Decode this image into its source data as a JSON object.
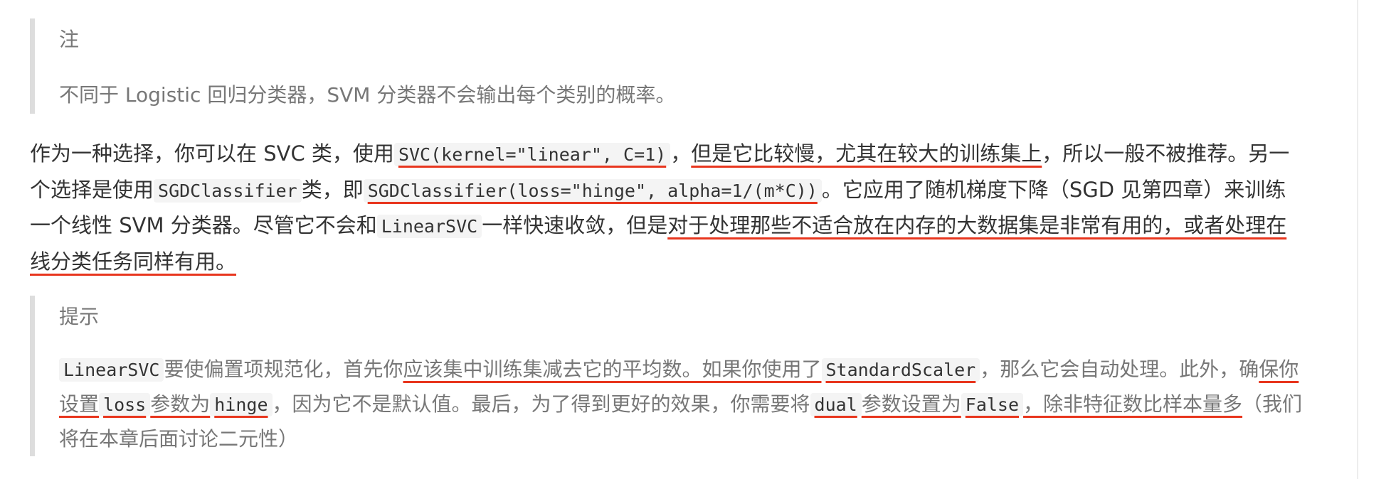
{
  "note": {
    "title": "注",
    "text": "不同于 Logistic 回归分类器，SVM 分类器不会输出每个类别的概率。"
  },
  "paragraph": {
    "p1": "作为一种选择，你可以在 SVC 类，使用",
    "code1": "SVC(kernel=\"linear\", C=1)",
    "p2": "，",
    "p3_u": "但是它比较慢，尤其在较大的训练集上",
    "p4": "，所以一般不被推荐。另一个选择是使用",
    "code2": "SGDClassifier",
    "p5": "类，即",
    "code3": "SGDClassifier(loss=\"hinge\", alpha=1/(m*C))",
    "p6": "。它应用了随机梯度下降（SGD 见第四章）来训练一个线性 SVM 分类器。尽管它不会和",
    "code4": "LinearSVC",
    "p7": "一样快速收敛，但是",
    "p8_u": "对于处理那些不适合放在内存的大数据集是非常有用的，或者处理在线分类任务同样有用。"
  },
  "tip": {
    "title": "提示",
    "code1": "LinearSVC",
    "t1": "要使偏置项规范化，首先你",
    "t2_u": "应该集中训练集减去它的平均数。如果你使用了",
    "code2": "StandardScaler",
    "t3": "，那么它会自动处理。此外，确",
    "t4_u": "保你设置",
    "code3": "loss",
    "t5_u": "参数为",
    "code4": "hinge",
    "t6": "，因为它不是默认值。最后，为了得到更好的效果，你需要将",
    "code5": "dual",
    "t7_u": "参数设置为",
    "code6": "False",
    "t8_u": "，除非特征数比样本量多",
    "t9": "（我们将在本章后面讨论二元性）"
  },
  "colors": {
    "annotation": "#e8361e",
    "quote_border": "#dddddd",
    "quote_text": "#777777",
    "body_text": "#333333",
    "code_bg": "#f4f4f4"
  }
}
